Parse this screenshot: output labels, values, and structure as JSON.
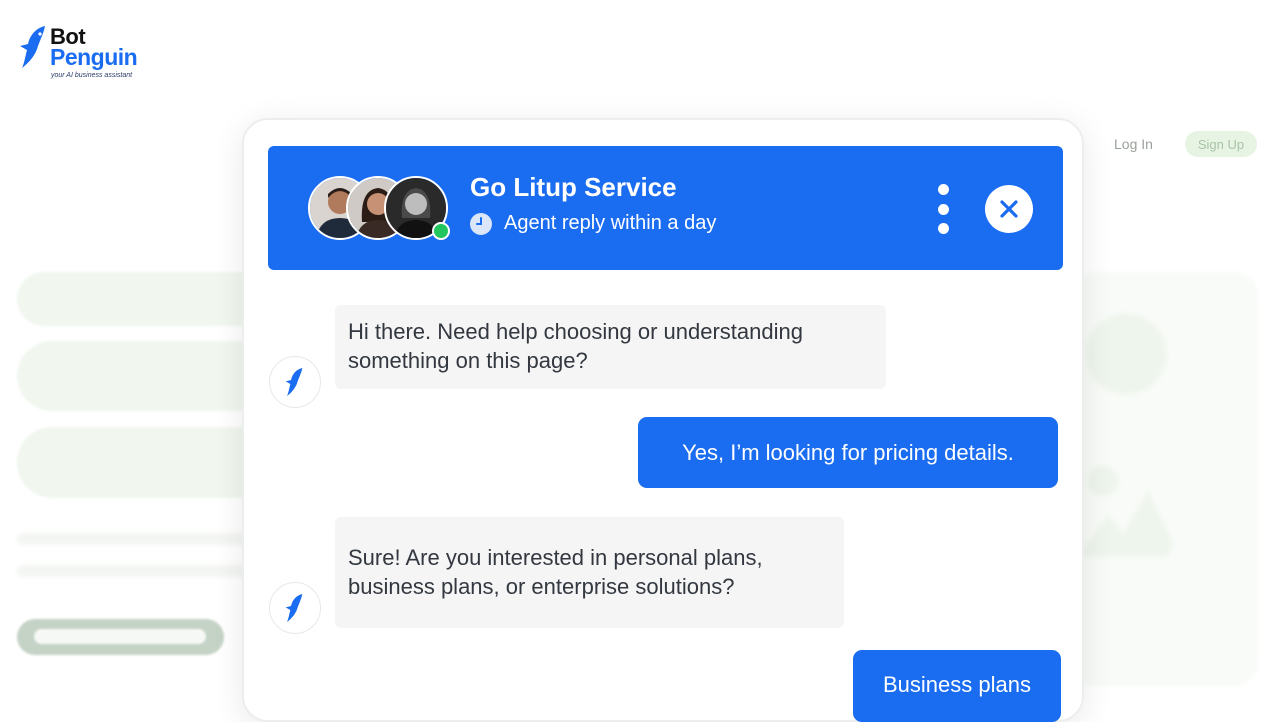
{
  "logo": {
    "line1": "Bot",
    "line2": "Penguin",
    "tagline": "your AI business assistant"
  },
  "nav": {
    "login_label": "Log In",
    "signup_label": "Sign Up"
  },
  "chat": {
    "header": {
      "title": "Go Litup Service",
      "subtitle": "Agent reply within a day",
      "status": "online"
    },
    "messages": [
      {
        "from": "bot",
        "text": "Hi there. Need help choosing or understanding something on this page?"
      },
      {
        "from": "user",
        "text": "Yes, I’m looking for pricing details."
      },
      {
        "from": "bot",
        "text": "Sure! Are you interested in personal plans, business plans, or enterprise solutions?"
      },
      {
        "from": "user",
        "text": "Business plans"
      }
    ]
  },
  "colors": {
    "brand_blue": "#1a6cf0",
    "online_green": "#22c55e",
    "bot_bubble": "#f5f5f5"
  },
  "icons": [
    "penguin-logo-icon",
    "clock-icon",
    "more-vertical-icon",
    "close-icon"
  ]
}
